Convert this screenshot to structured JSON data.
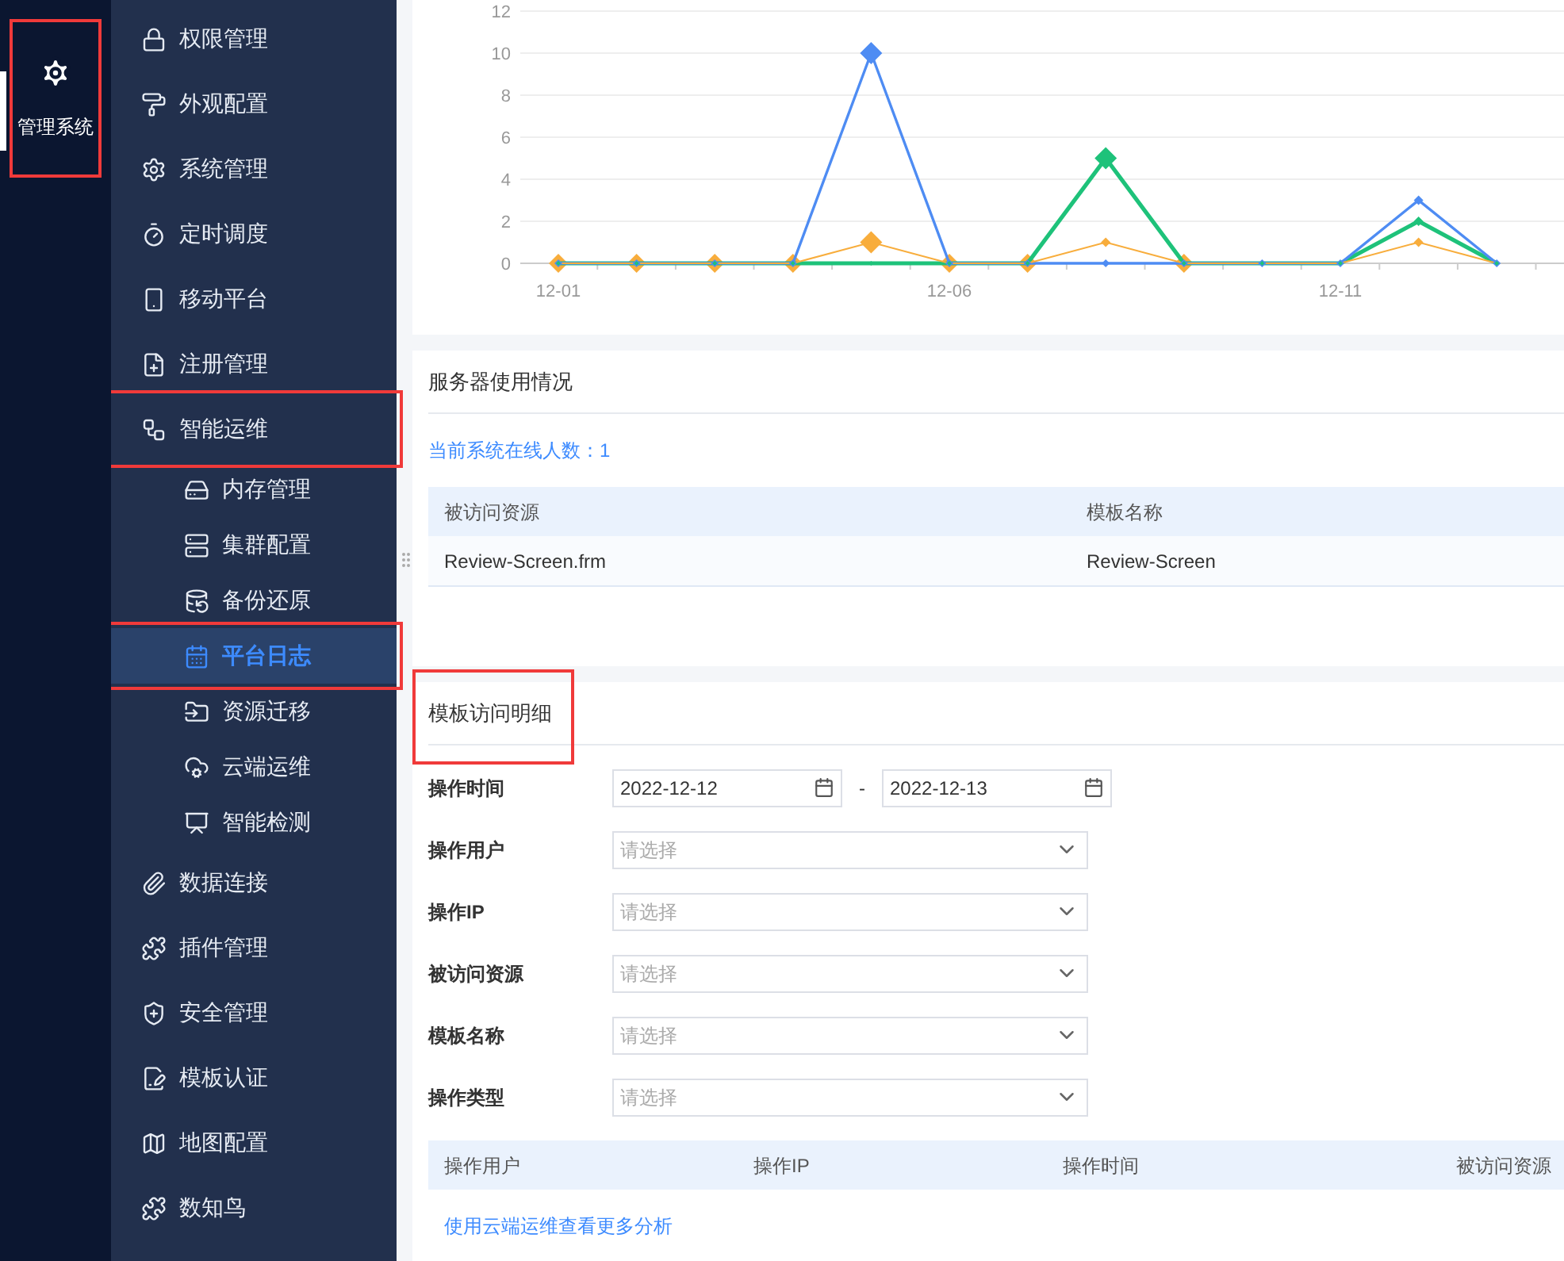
{
  "rail": {
    "label": "管理系统",
    "selected": true,
    "highlighted": true
  },
  "sidebar": {
    "items": [
      {
        "label": "权限管理",
        "selected": false,
        "highlighted": false
      },
      {
        "label": "外观配置",
        "selected": false,
        "highlighted": false
      },
      {
        "label": "系统管理",
        "selected": false,
        "highlighted": false
      },
      {
        "label": "定时调度",
        "selected": false,
        "highlighted": false
      },
      {
        "label": "移动平台",
        "selected": false,
        "highlighted": false
      },
      {
        "label": "注册管理",
        "selected": false,
        "highlighted": false
      },
      {
        "label": "智能运维",
        "selected": false,
        "highlighted": true,
        "children": [
          {
            "label": "内存管理",
            "selected": false,
            "highlighted": false
          },
          {
            "label": "集群配置",
            "selected": false,
            "highlighted": false
          },
          {
            "label": "备份还原",
            "selected": false,
            "highlighted": false
          },
          {
            "label": "平台日志",
            "selected": true,
            "highlighted": true
          },
          {
            "label": "资源迁移",
            "selected": false,
            "highlighted": false
          },
          {
            "label": "云端运维",
            "selected": false,
            "highlighted": false
          },
          {
            "label": "智能检测",
            "selected": false,
            "highlighted": false
          }
        ]
      },
      {
        "label": "数据连接",
        "selected": false,
        "highlighted": false
      },
      {
        "label": "插件管理",
        "selected": false,
        "highlighted": false
      },
      {
        "label": "安全管理",
        "selected": false,
        "highlighted": false
      },
      {
        "label": "模板认证",
        "selected": false,
        "highlighted": false
      },
      {
        "label": "地图配置",
        "selected": false,
        "highlighted": false
      },
      {
        "label": "数知鸟",
        "selected": false,
        "highlighted": false
      }
    ]
  },
  "chart": {
    "chart_data": {
      "type": "line",
      "grid": true,
      "categories": [
        "12-01",
        null,
        null,
        null,
        null,
        "12-06",
        null,
        null,
        null,
        null,
        "12-11",
        null,
        null
      ],
      "ylim": [
        0,
        12
      ],
      "yticks": [
        0,
        2,
        4,
        6,
        8,
        10,
        12
      ],
      "series": [
        {
          "color": "#4e8cf3",
          "marker": "diamond",
          "values": [
            0,
            0,
            0,
            0,
            10,
            0,
            0,
            0,
            0,
            0,
            0,
            3,
            0
          ]
        },
        {
          "color": "#1ec27a",
          "marker": "diamond",
          "values": [
            0,
            0,
            0,
            0,
            0,
            0,
            0,
            5,
            0,
            0,
            0,
            2,
            0
          ]
        },
        {
          "color": "#f8ad3c",
          "marker": "diamond",
          "values": [
            0,
            0,
            0,
            0,
            1,
            0,
            0,
            1,
            0,
            0,
            0,
            1,
            0
          ]
        }
      ]
    }
  },
  "server_usage": {
    "title": "服务器使用情况",
    "online_users": "当前系统在线人数：1",
    "table": {
      "columns": [
        "被访问资源",
        "模板名称"
      ],
      "rows": [
        [
          "Review-Screen.frm",
          "Review-Screen"
        ]
      ]
    }
  },
  "template_details": {
    "title": "模板访问明细",
    "highlighted": true,
    "date_range": {
      "label": "操作时间",
      "start": "2022-12-12",
      "separator": "-",
      "end": "2022-12-13"
    },
    "filters": [
      {
        "label": "操作用户",
        "placeholder": "请选择"
      },
      {
        "label": "操作IP",
        "placeholder": "请选择"
      },
      {
        "label": "被访问资源",
        "placeholder": "请选择"
      },
      {
        "label": "模板名称",
        "placeholder": "请选择"
      },
      {
        "label": "操作类型",
        "placeholder": "请选择"
      }
    ],
    "table": {
      "columns": [
        "操作用户",
        "操作IP",
        "操作时间",
        "被访问资源"
      ]
    },
    "link": "使用云端运维查看更多分析"
  }
}
